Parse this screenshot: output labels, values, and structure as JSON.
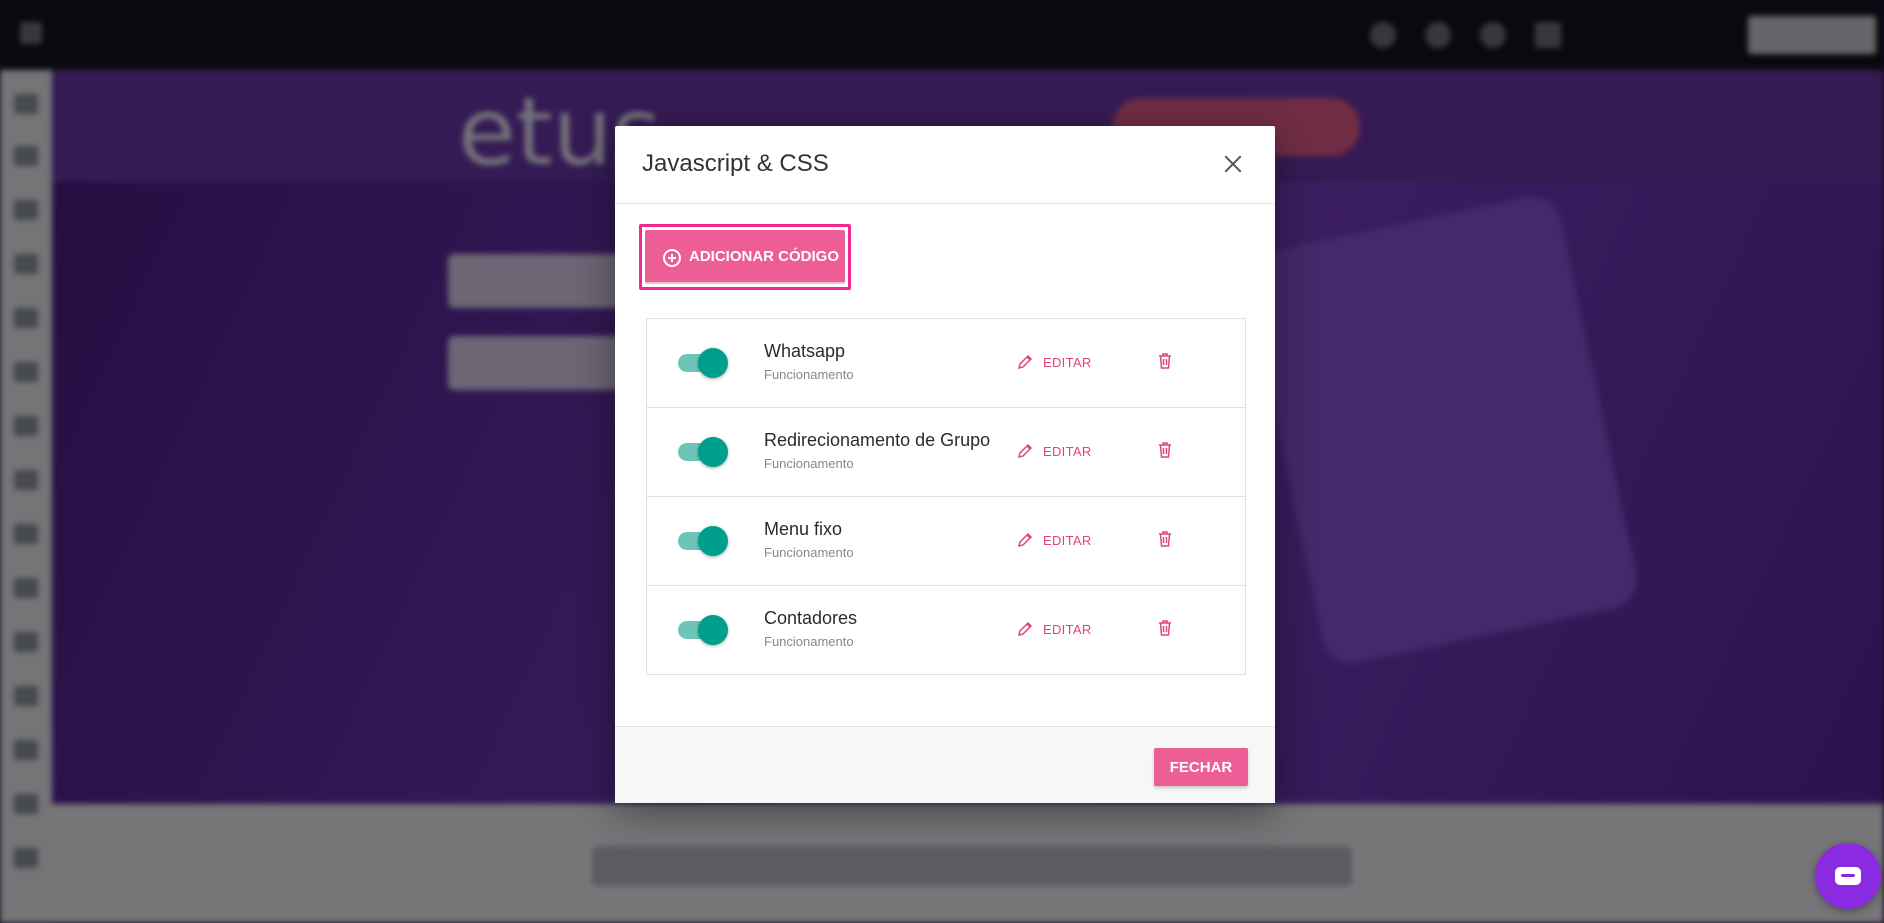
{
  "modal": {
    "title": "Javascript & CSS",
    "add_button_label": "ADICIONAR CÓDIGO",
    "edit_label": "EDITAR",
    "close_button_label": "FECHAR",
    "scripts": [
      {
        "name": "Whatsapp",
        "status": "Funcionamento",
        "enabled": true
      },
      {
        "name": "Redirecionamento de Grupo",
        "status": "Funcionamento",
        "enabled": true
      },
      {
        "name": "Menu fixo",
        "status": "Funcionamento",
        "enabled": true
      },
      {
        "name": "Contadores",
        "status": "Funcionamento",
        "enabled": true
      }
    ]
  },
  "colors": {
    "accent": "#ec5e95",
    "toggle_on": "#009e8c",
    "overlay": "rgba(0,0,0,0.5)",
    "chat": "#8a2be2"
  },
  "icons": {
    "close": "close-icon",
    "add": "plus-circle-icon",
    "edit": "pencil-icon",
    "delete": "trash-icon",
    "chat": "chat-icon"
  }
}
